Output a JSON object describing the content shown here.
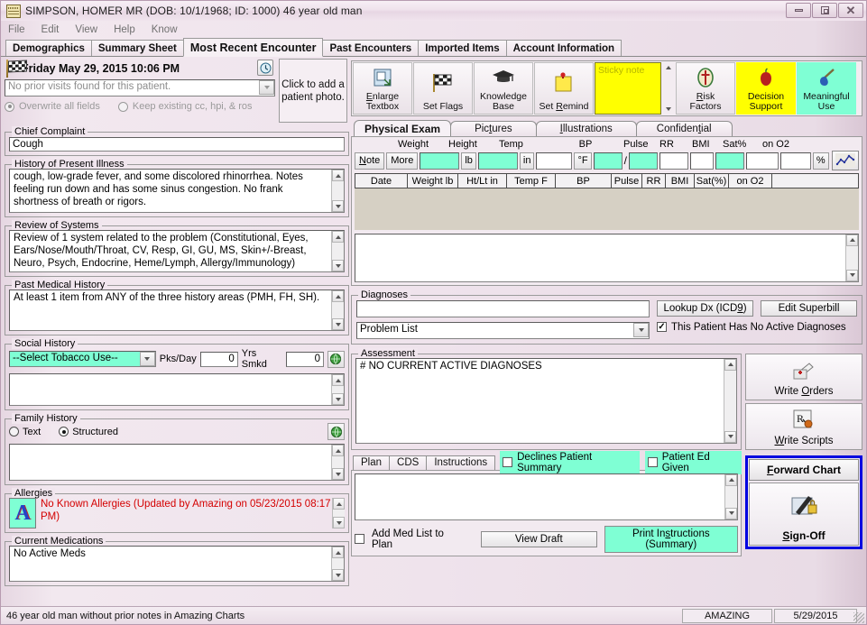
{
  "window": {
    "title": "SIMPSON, HOMER MR (DOB: 10/1/1968; ID: 1000) 46 year old man",
    "icon": "chart-icon",
    "minimize": "–",
    "maximize": "❐",
    "close": "✕"
  },
  "menu": {
    "items": [
      "File",
      "Edit",
      "View",
      "Help",
      "Know"
    ]
  },
  "tabs": {
    "items": [
      {
        "label": "Demographics",
        "active": false
      },
      {
        "label": "Summary Sheet",
        "active": false
      },
      {
        "label": "Most Recent Encounter",
        "active": true
      },
      {
        "label": "Past Encounters",
        "active": false
      },
      {
        "label": "Imported Items",
        "active": false
      },
      {
        "label": "Account Information",
        "active": false
      }
    ]
  },
  "visit": {
    "date_text": "Friday May 29, 2015  10:06 PM",
    "prior_visits_placeholder": "No prior visits found for this patient.",
    "radio_overwrite": "Overwrite all fields",
    "radio_keep": "Keep existing cc, hpi, & ros",
    "photo_prompt": "Click to add a patient photo."
  },
  "chief_complaint": {
    "legend": "Chief Complaint",
    "value": "Cough"
  },
  "hpi": {
    "legend": "History of Present Illness",
    "value": "cough, low-grade fever, and some discolored rhinorrhea. Notes feeling run down and has some sinus congestion. No frank shortness of breath or rigors."
  },
  "ros": {
    "legend": "Review of Systems",
    "value": "Review of 1 system related to the problem (Constitutional, Eyes, Ears/Nose/Mouth/Throat, CV, Resp, GI, GU, MS, Skin+/-Breast, Neuro, Psych, Endocrine, Heme/Lymph, Allergy/Immunology)"
  },
  "pmh": {
    "legend": "Past Medical History",
    "value": "At least 1 item from ANY of the three history areas (PMH, FH, SH)."
  },
  "social_history": {
    "legend": "Social History",
    "tobacco_select": "--Select Tobacco Use--",
    "pks_label": "Pks/Day",
    "pks_value": "0",
    "yrs_label": "Yrs Smkd",
    "yrs_value": "0",
    "notes": ""
  },
  "family_history": {
    "legend": "Family History",
    "radio_text": "Text",
    "radio_structured": "Structured",
    "notes": ""
  },
  "allergies": {
    "legend": "Allergies",
    "value": "No Known Allergies (Updated by Amazing on 05/23/2015 08:17 PM)"
  },
  "current_meds": {
    "legend": "Current Medications",
    "value": "No Active Meds"
  },
  "toolbar": {
    "buttons": [
      {
        "label_1": "Enlarge",
        "label_2": "Textbox",
        "icon": "enlarge-textbox-icon",
        "style": "plain"
      },
      {
        "label_1": "Set Flags",
        "label_2": "",
        "icon": "set-flags-icon",
        "style": "plain"
      },
      {
        "label_1": "Knowledge",
        "label_2": "Base",
        "icon": "knowledge-base-icon",
        "style": "plain"
      },
      {
        "label_1": "Set Remind",
        "label_2": "",
        "icon": "set-remind-icon",
        "style": "plain"
      }
    ],
    "sticky_note_placeholder": "Sticky note",
    "right_buttons": [
      {
        "label_1": "Risk",
        "label_2": "Factors",
        "icon": "risk-factors-icon",
        "style": "plain"
      },
      {
        "label_1": "Decision",
        "label_2": "Support",
        "icon": "decision-support-icon",
        "style": "yellow"
      },
      {
        "label_1": "Meaningful",
        "label_2": "Use",
        "icon": "meaningful-use-icon",
        "style": "mint"
      }
    ]
  },
  "exam_tabs": {
    "items": [
      {
        "label": "Physical Exam",
        "active": true
      },
      {
        "label": "Pictures",
        "active": false
      },
      {
        "label": "Illustrations",
        "active": false
      },
      {
        "label": "Confidential",
        "active": false
      }
    ]
  },
  "vitals": {
    "headers": [
      "Weight",
      "Height",
      "Temp",
      "BP",
      "Pulse",
      "RR",
      "BMI",
      "Sat%",
      "on O2"
    ],
    "note_button": "Note",
    "more_button": "More",
    "unit_weight": "lb",
    "unit_height": "in",
    "unit_temp": "°F",
    "bp_separator": "/",
    "unit_sat": "%",
    "graph_icon": "vitals-graph-icon",
    "values": {
      "weight": "",
      "height": "",
      "temp": "",
      "bp_systolic": "",
      "bp_diastolic": "",
      "pulse": "",
      "rr": "",
      "bmi": "",
      "sat": "",
      "on_o2": ""
    },
    "table_headers": [
      "Date",
      "Weight lb",
      "Ht/Lt in",
      "Temp F",
      "BP",
      "Pulse",
      "RR",
      "BMI",
      "Sat(%)",
      "on O2",
      ""
    ],
    "rows": []
  },
  "exam_notes": {
    "value": ""
  },
  "diagnoses": {
    "legend": "Diagnoses",
    "dx_value": "",
    "problem_list_value": "Problem List",
    "lookup_button": "Lookup Dx (ICD9)",
    "superbill_button": "Edit Superbill",
    "no_active_checkbox": "This Patient Has No Active Diagnoses",
    "no_active_checked": true
  },
  "assessment": {
    "legend": "Assessment",
    "value": "# NO CURRENT ACTIVE DIAGNOSES"
  },
  "plan": {
    "tabs": [
      {
        "label": "Plan",
        "active": true
      },
      {
        "label": "CDS",
        "active": false
      },
      {
        "label": "Instructions",
        "active": false
      }
    ],
    "declines_summary": "Declines Patient Summary",
    "declines_checked": false,
    "patient_ed": "Patient Ed Given",
    "patient_ed_checked": false,
    "value": "",
    "add_med_list": "Add Med List to Plan",
    "add_med_checked": false,
    "view_draft": "View Draft",
    "print_instructions": "Print Instructions (Summary)"
  },
  "side_buttons": {
    "write_orders": "Write Orders",
    "write_scripts": "Write Scripts",
    "forward_chart": "Forward Chart",
    "sign_off": "Sign-Off"
  },
  "statusbar": {
    "message": "46 year old man without prior notes in Amazing Charts",
    "user": "AMAZING",
    "date": "5/29/2015"
  },
  "colors": {
    "mint": "#7fffd4",
    "yellow": "#ffff00",
    "alert_red": "#d40000",
    "signoff_border": "#0000e0"
  }
}
